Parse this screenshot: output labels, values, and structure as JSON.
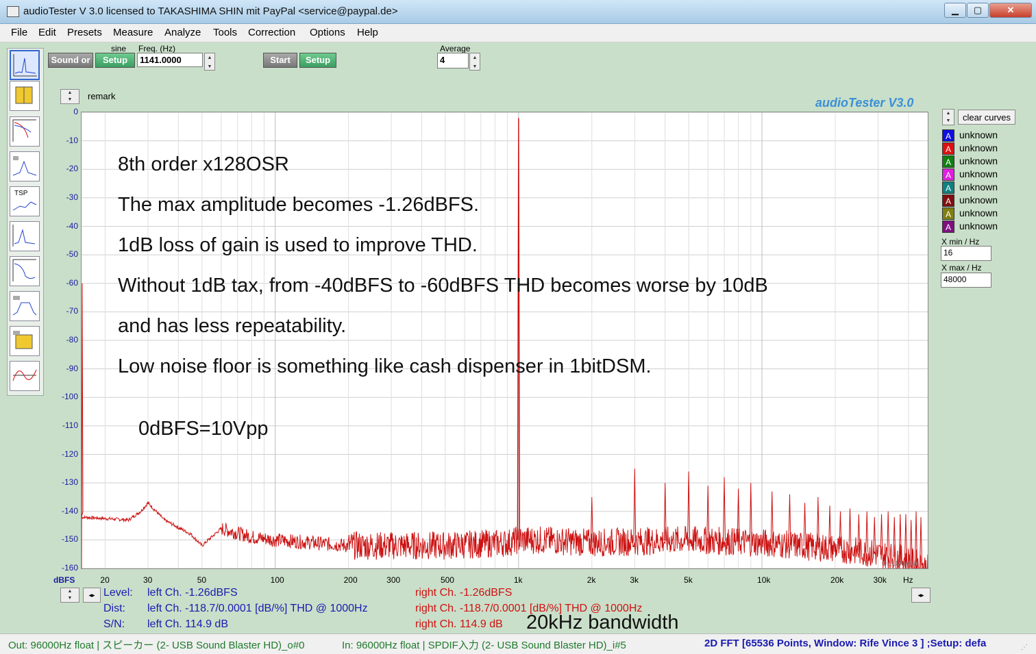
{
  "window": {
    "title": "audioTester  V 3.0   licensed to TAKASHIMA SHIN mit PayPal <service@paypal.de>",
    "btn_min": "▁",
    "btn_max": "▢",
    "btn_close": "✕"
  },
  "menu": [
    "File",
    "Edit",
    "Presets",
    "Measure",
    "Analyze",
    "Tools",
    "Correction",
    "Options",
    "Help"
  ],
  "toolbar": {
    "sound_label": "Sound or",
    "sine_label": "sine",
    "setup1": "Setup",
    "freq_label": "Freq. (Hz)",
    "freq_value": "1141.0000",
    "start": "Start",
    "setup2": "Setup",
    "average_label": "Average",
    "average_value": "4"
  },
  "remark_label": "remark",
  "plot_brand": "audioTester  V3.0",
  "clear_curves": "clear curves",
  "copyright": "© U.Mueller",
  "legend": [
    {
      "label": "unknown",
      "color": "#1010e0",
      "letter": "A"
    },
    {
      "label": "unknown",
      "color": "#e01010",
      "letter": "A"
    },
    {
      "label": "unknown",
      "color": "#108010",
      "letter": "A"
    },
    {
      "label": "unknown",
      "color": "#e020e0",
      "letter": "A"
    },
    {
      "label": "unknown",
      "color": "#108080",
      "letter": "A"
    },
    {
      "label": "unknown",
      "color": "#801010",
      "letter": "A"
    },
    {
      "label": "unknown",
      "color": "#808010",
      "letter": "A"
    },
    {
      "label": "unknown",
      "color": "#801080",
      "letter": "A"
    }
  ],
  "xrange": {
    "xmin_label": "X min / Hz",
    "xmin_value": "16",
    "xmax_label": "X max / Hz",
    "xmax_value": "48000"
  },
  "y_unit": "dBFS",
  "x_unit": "Hz",
  "y_ticks": [
    "0",
    "-10",
    "-20",
    "-30",
    "-40",
    "-50",
    "-60",
    "-70",
    "-80",
    "-90",
    "-100",
    "-110",
    "-120",
    "-130",
    "-140",
    "-150",
    "-160"
  ],
  "x_ticks": [
    {
      "label": "20",
      "value": 20
    },
    {
      "label": "30",
      "value": 30
    },
    {
      "label": "50",
      "value": 50
    },
    {
      "label": "100",
      "value": 100
    },
    {
      "label": "200",
      "value": 200
    },
    {
      "label": "300",
      "value": 300
    },
    {
      "label": "500",
      "value": 500
    },
    {
      "label": "1k",
      "value": 1000
    },
    {
      "label": "2k",
      "value": 2000
    },
    {
      "label": "3k",
      "value": 3000
    },
    {
      "label": "5k",
      "value": 5000
    },
    {
      "label": "10k",
      "value": 10000
    },
    {
      "label": "20k",
      "value": 20000
    },
    {
      "label": "30k",
      "value": 30000
    }
  ],
  "annotations": [
    "8th order x128OSR",
    "The max amplitude becomes -1.26dBFS.",
    "1dB loss of gain is used to improve THD.",
    "Without 1dB tax, from -40dBFS to -60dBFS THD becomes worse by 10dB",
    "and has less repeatability.",
    "Low noise floor is something like cash dispenser in 1bitDSM.",
    "0dBFS=10Vpp"
  ],
  "chart_data": {
    "type": "line",
    "xscale": "log",
    "xlim": [
      16,
      48000
    ],
    "ylim": [
      -160,
      0
    ],
    "grid": true,
    "series": [
      {
        "color": "#cc1111",
        "noise_floor": [
          [
            16,
            -142
          ],
          [
            20,
            -142.5
          ],
          [
            25,
            -143
          ],
          [
            28,
            -140
          ],
          [
            30,
            -137
          ],
          [
            35,
            -143
          ],
          [
            45,
            -148
          ],
          [
            50,
            -152
          ],
          [
            60,
            -146
          ],
          [
            80,
            -149
          ],
          [
            100,
            -150
          ],
          [
            200,
            -152
          ],
          [
            500,
            -152
          ],
          [
            900,
            -151
          ],
          [
            1000,
            -150
          ],
          [
            1200,
            -150
          ],
          [
            2000,
            -151
          ],
          [
            5000,
            -150
          ],
          [
            10000,
            -151
          ],
          [
            20000,
            -153
          ],
          [
            30000,
            -155
          ],
          [
            40000,
            -157
          ],
          [
            48000,
            -160
          ]
        ],
        "peaks": [
          {
            "x": 1000,
            "y": -2
          },
          {
            "x": 2000,
            "y": -135
          },
          {
            "x": 3000,
            "y": -125
          },
          {
            "x": 4000,
            "y": -130
          },
          {
            "x": 5000,
            "y": -126
          },
          {
            "x": 6000,
            "y": -131
          },
          {
            "x": 7000,
            "y": -128
          },
          {
            "x": 8000,
            "y": -132
          },
          {
            "x": 9000,
            "y": -130
          },
          {
            "x": 11000,
            "y": -133
          },
          {
            "x": 13000,
            "y": -134
          },
          {
            "x": 15000,
            "y": -137
          },
          {
            "x": 17000,
            "y": -135
          },
          {
            "x": 19000,
            "y": -138
          },
          {
            "x": 21000,
            "y": -140
          },
          {
            "x": 23000,
            "y": -139
          },
          {
            "x": 25000,
            "y": -141
          },
          {
            "x": 27000,
            "y": -140
          },
          {
            "x": 29000,
            "y": -142
          },
          {
            "x": 31000,
            "y": -141
          },
          {
            "x": 33000,
            "y": -140
          },
          {
            "x": 35000,
            "y": -142
          },
          {
            "x": 37000,
            "y": -141
          },
          {
            "x": 39000,
            "y": -141
          },
          {
            "x": 41000,
            "y": -143
          },
          {
            "x": 43000,
            "y": -140
          },
          {
            "x": 45000,
            "y": -142
          }
        ]
      }
    ]
  },
  "readout": {
    "level_label": "Level:",
    "level_left": "left Ch. -1.26dBFS",
    "level_right": "right Ch. -1.26dBFS",
    "dist_label": "Dist:",
    "dist_left": "left Ch. -118.7/0.0001 [dB/%] THD @ 1000Hz",
    "dist_right": "right Ch. -118.7/0.0001 [dB/%] THD @ 1000Hz",
    "sn_label": "S/N:",
    "sn_left": "left Ch. 114.9 dB",
    "sn_right": "right Ch. 114.9 dB",
    "bandwidth_note": "20kHz bandwidth"
  },
  "status": {
    "out": "Out: 96000Hz float  | スピーカー (2- USB Sound Blaster HD)_o#0",
    "in": "In: 96000Hz float  | SPDIF入力 (2- USB Sound Blaster HD)_i#5",
    "fft": "2D FFT [65536 Points, Window: Rife Vince 3 ]  ;Setup:  defa"
  }
}
